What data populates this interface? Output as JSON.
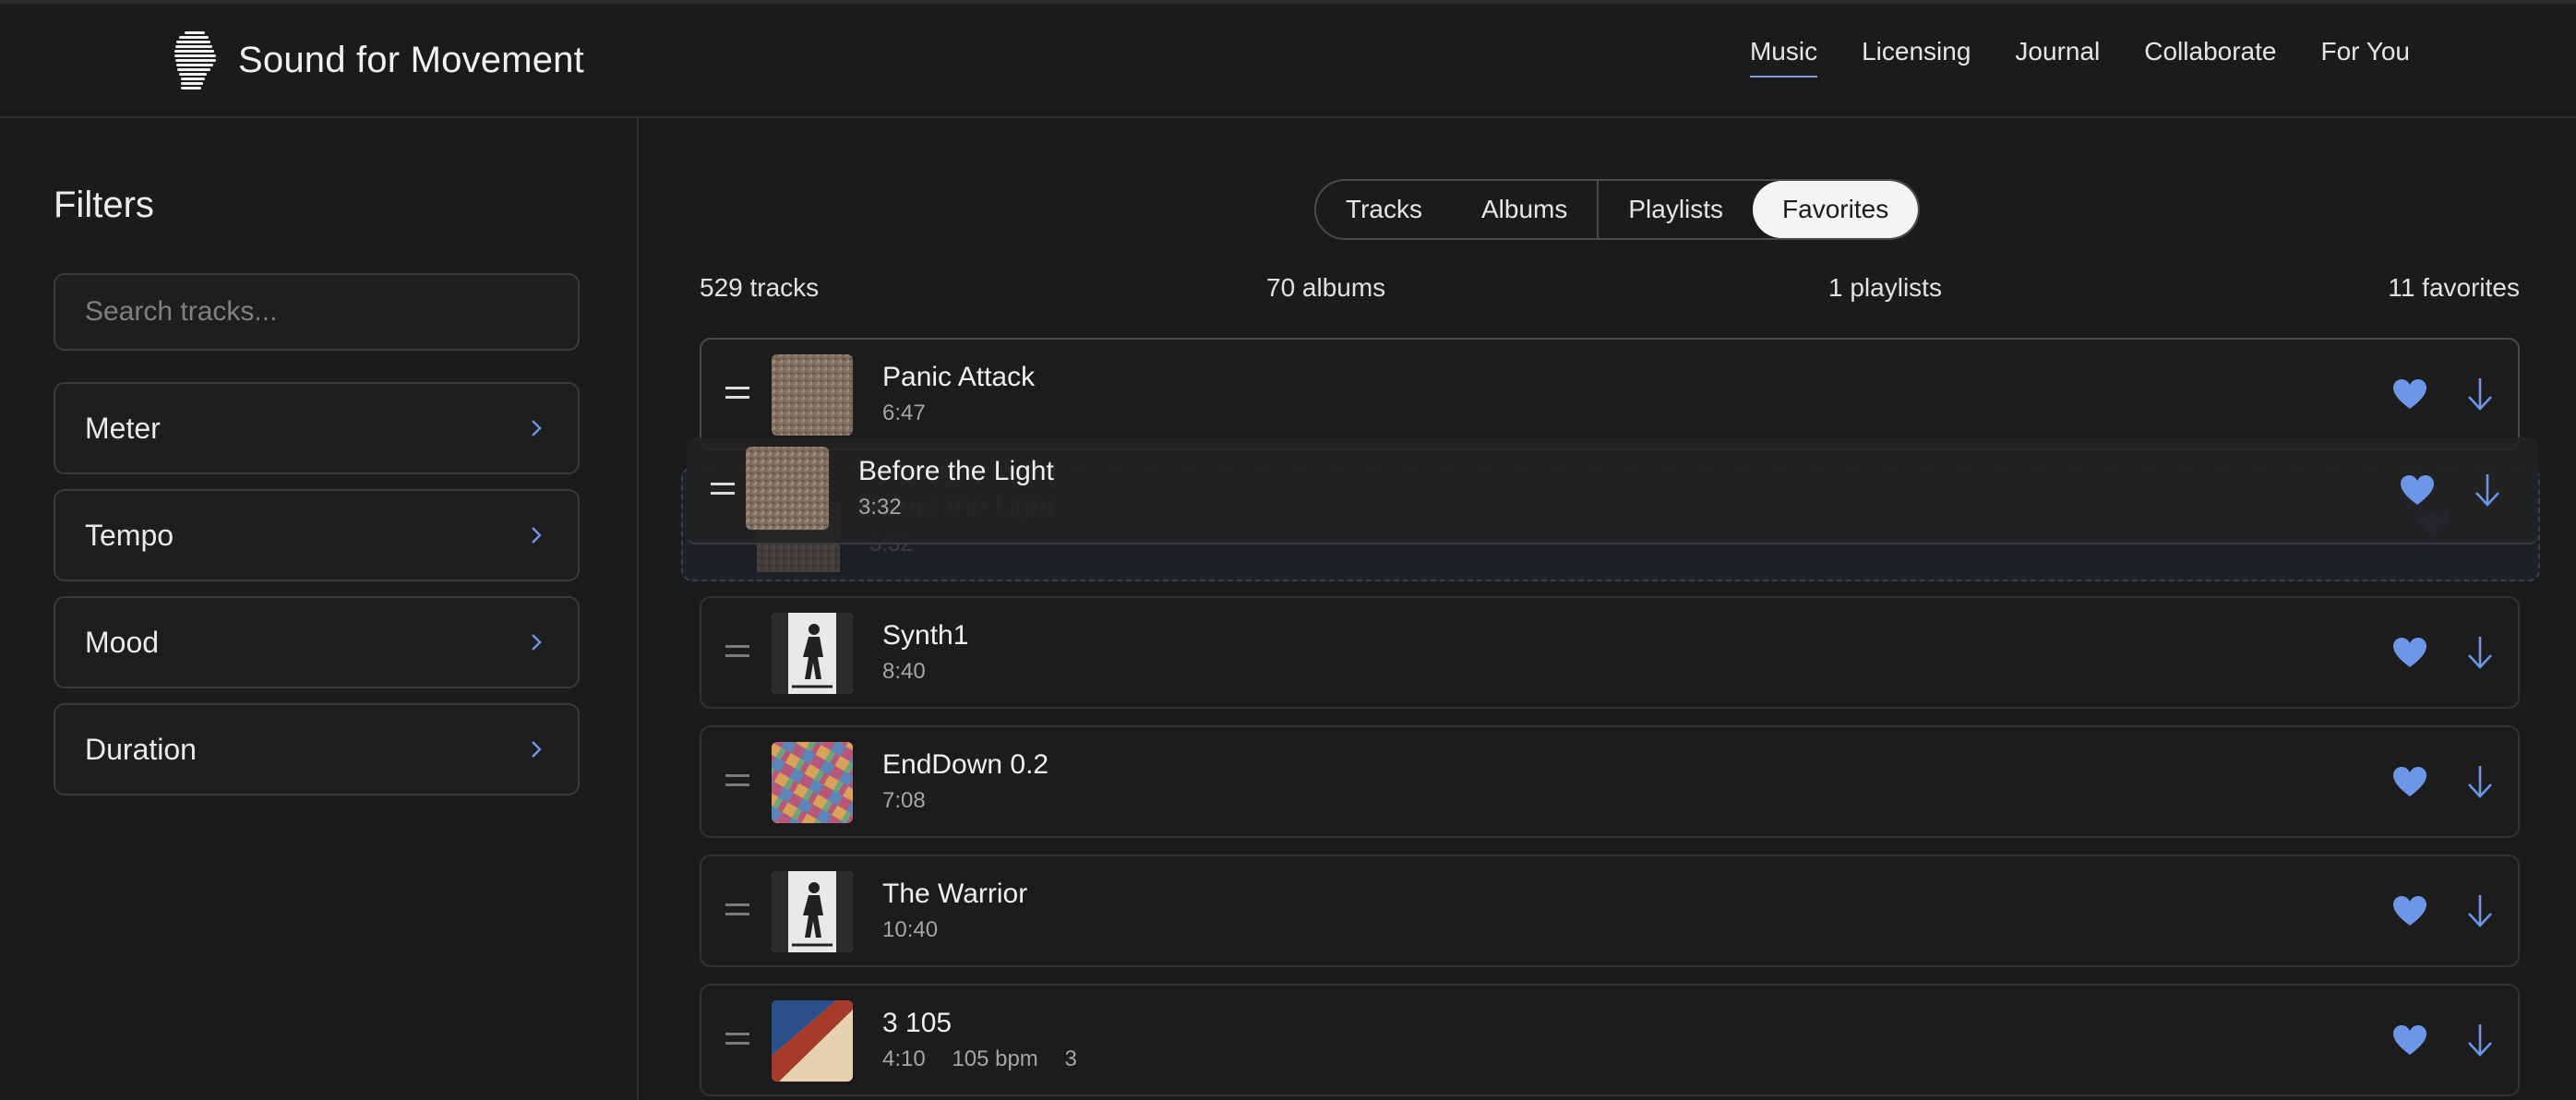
{
  "brand": {
    "name": "Sound for Movement",
    "logo_icon": "head-profile-icon"
  },
  "nav": {
    "items": [
      {
        "label": "Music",
        "active": true
      },
      {
        "label": "Licensing"
      },
      {
        "label": "Journal"
      },
      {
        "label": "Collaborate"
      },
      {
        "label": "For You"
      }
    ]
  },
  "sidebar": {
    "title": "Filters",
    "search_placeholder": "Search tracks...",
    "filters": [
      {
        "label": "Meter"
      },
      {
        "label": "Tempo"
      },
      {
        "label": "Mood"
      },
      {
        "label": "Duration"
      }
    ]
  },
  "tabs": [
    {
      "label": "Tracks"
    },
    {
      "label": "Albums"
    },
    {
      "label": "Playlists"
    },
    {
      "label": "Favorites",
      "active": true
    }
  ],
  "counts": {
    "tracks": "529 tracks",
    "albums": "70 albums",
    "playlists": "1 playlists",
    "favorites": "11 favorites"
  },
  "tracks": [
    {
      "title": "Panic Attack",
      "duration": "6:47",
      "art": "burlap"
    },
    {
      "title": "Before the Light",
      "duration": "3:32",
      "art": "burlap",
      "dragging": true
    },
    {
      "title": "Synth1",
      "duration": "8:40",
      "art": "figure"
    },
    {
      "title": "EndDown 0.2",
      "duration": "7:08",
      "art": "mosaic"
    },
    {
      "title": "The Warrior",
      "duration": "10:40",
      "art": "figure"
    },
    {
      "title": "3 105",
      "duration": "4:10",
      "bpm": "105 bpm",
      "meter": "3",
      "art": "flag"
    }
  ],
  "colors": {
    "accent": "#6d95e8",
    "background": "#1b1b1c",
    "border": "#3a3a3c"
  }
}
